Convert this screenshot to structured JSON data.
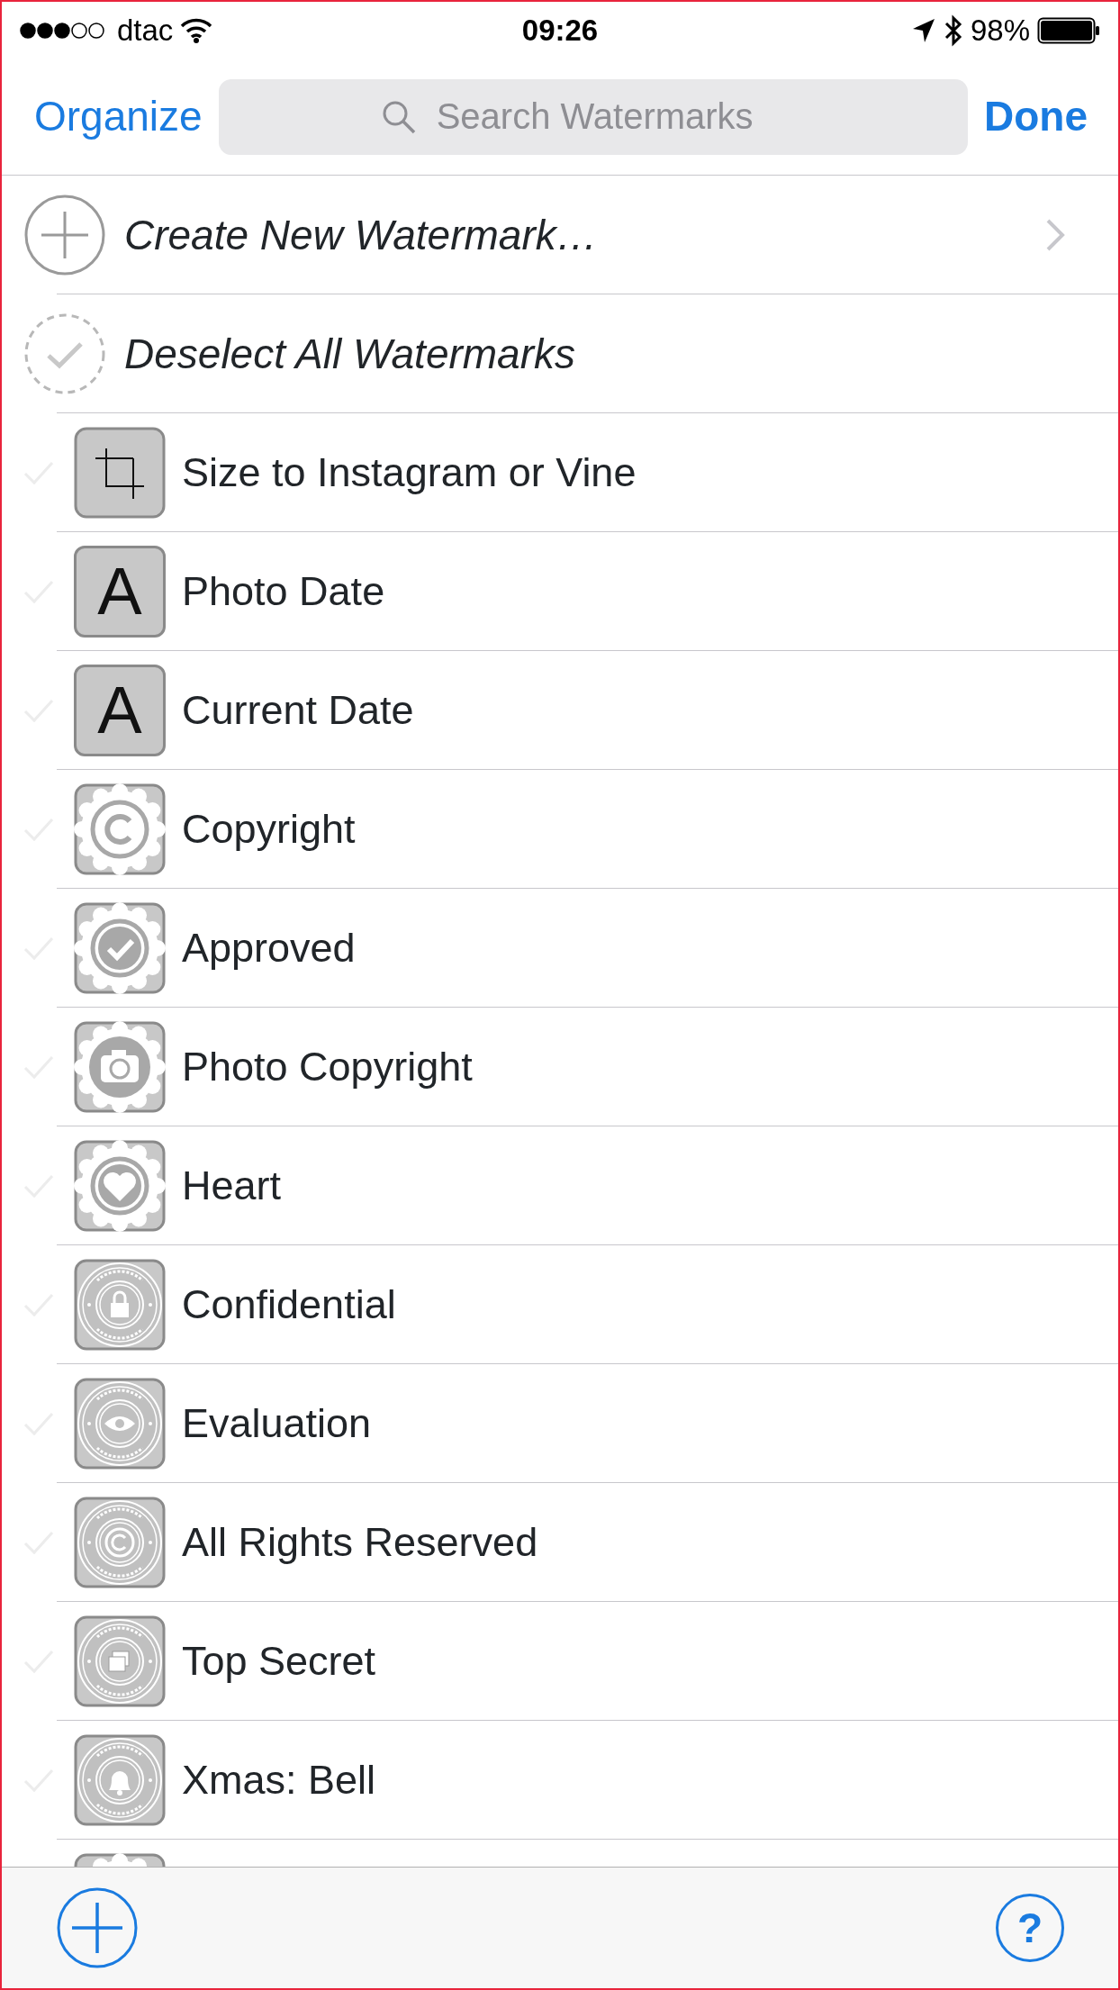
{
  "status_bar": {
    "carrier": "dtac",
    "time": "09:26",
    "battery": "98%"
  },
  "nav": {
    "left_button": "Organize",
    "search": {
      "placeholder": "Search Watermarks"
    },
    "right_button": "Done"
  },
  "actions": [
    {
      "kind": "create",
      "label": "Create New Watermark…"
    },
    {
      "kind": "deselect",
      "label": "Deselect All Watermarks"
    }
  ],
  "watermarks": [
    {
      "label": "Size to Instagram or Vine",
      "kind": "crop",
      "checked": false
    },
    {
      "label": "Photo Date",
      "kind": "letter",
      "glyph": "A",
      "checked": false
    },
    {
      "label": "Current Date",
      "kind": "letter",
      "glyph": "A",
      "checked": false
    },
    {
      "label": "Copyright",
      "kind": "badge",
      "checked": false
    },
    {
      "label": "Approved",
      "kind": "badge",
      "checked": false
    },
    {
      "label": "Photo Copyright",
      "kind": "badge",
      "checked": false
    },
    {
      "label": "Heart",
      "kind": "badge",
      "checked": false
    },
    {
      "label": "Confidential",
      "kind": "seal",
      "checked": false
    },
    {
      "label": "Evaluation",
      "kind": "seal",
      "checked": false
    },
    {
      "label": "All Rights Reserved",
      "kind": "seal",
      "checked": false
    },
    {
      "label": "Top Secret",
      "kind": "seal",
      "checked": false
    },
    {
      "label": "Xmas: Bell",
      "kind": "seal",
      "checked": false
    },
    {
      "kind": "badge"
    }
  ],
  "toolbar": {
    "help_glyph": "?"
  }
}
